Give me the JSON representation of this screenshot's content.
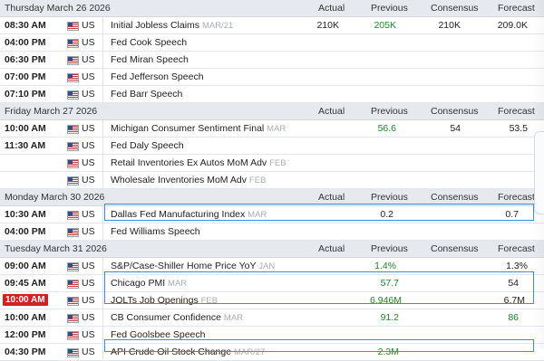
{
  "columns": {
    "actual": "Actual",
    "previous": "Previous",
    "consensus": "Consensus",
    "forecast": "Forecast"
  },
  "days": [
    {
      "date": "Thursday March 26 2026",
      "events": [
        {
          "time": "08:30 AM",
          "country": "US",
          "event": "Initial Jobless Claims",
          "ref": "MAR/21",
          "actual": "210K",
          "previous": "205K",
          "consensus": "210K",
          "forecast": "209.0K"
        },
        {
          "time": "04:00 PM",
          "country": "US",
          "event": "Fed Cook Speech",
          "ref": "",
          "actual": "",
          "previous": "",
          "consensus": "",
          "forecast": ""
        },
        {
          "time": "06:30 PM",
          "country": "US",
          "event": "Fed Miran Speech",
          "ref": "",
          "actual": "",
          "previous": "",
          "consensus": "",
          "forecast": ""
        },
        {
          "time": "07:00 PM",
          "country": "US",
          "event": "Fed Jefferson Speech",
          "ref": "",
          "actual": "",
          "previous": "",
          "consensus": "",
          "forecast": ""
        },
        {
          "time": "07:10 PM",
          "country": "US",
          "event": "Fed Barr Speech",
          "ref": "",
          "actual": "",
          "previous": "",
          "consensus": "",
          "forecast": ""
        }
      ]
    },
    {
      "date": "Friday March 27 2026",
      "events": [
        {
          "time": "10:00 AM",
          "country": "US",
          "event": "Michigan Consumer Sentiment Final",
          "ref": "MAR",
          "actual": "",
          "previous": "56.6",
          "consensus": "54",
          "forecast": "53.5"
        },
        {
          "time": "11:30 AM",
          "country": "US",
          "event": "Fed Daly Speech",
          "ref": "",
          "actual": "",
          "previous": "",
          "consensus": "",
          "forecast": ""
        },
        {
          "time": "",
          "country": "US",
          "event": "Retail Inventories Ex Autos MoM Adv",
          "ref": "FEB",
          "actual": "",
          "previous": "",
          "consensus": "",
          "forecast": ""
        },
        {
          "time": "",
          "country": "US",
          "event": "Wholesale Inventories MoM Adv",
          "ref": "FEB",
          "actual": "",
          "previous": "",
          "consensus": "",
          "forecast": ""
        }
      ]
    },
    {
      "date": "Monday March 30 2026",
      "events": [
        {
          "time": "10:30 AM",
          "country": "US",
          "event": "Dallas Fed Manufacturing Index",
          "ref": "MAR",
          "actual": "",
          "previous": "0.2",
          "consensus": "",
          "forecast": "0.7"
        },
        {
          "time": "04:00 PM",
          "country": "US",
          "event": "Fed Williams Speech",
          "ref": "",
          "actual": "",
          "previous": "",
          "consensus": "",
          "forecast": ""
        }
      ]
    },
    {
      "date": "Tuesday March 31 2026",
      "events": [
        {
          "time": "09:00 AM",
          "country": "US",
          "event": "S&P/Case-Shiller Home Price YoY",
          "ref": "JAN",
          "actual": "",
          "previous": "1.4%",
          "consensus": "",
          "forecast": "1.3%"
        },
        {
          "time": "09:45 AM",
          "country": "US",
          "event": "Chicago PMI",
          "ref": "MAR",
          "actual": "",
          "previous": "57.7",
          "consensus": "",
          "forecast": "54"
        },
        {
          "time": "10:00 AM",
          "country": "US",
          "event": "JOLTs Job Openings",
          "ref": "FEB",
          "actual": "",
          "previous": "6.946M",
          "consensus": "",
          "forecast": "6.7M"
        },
        {
          "time": "10:00 AM",
          "country": "US",
          "event": "CB Consumer Confidence",
          "ref": "MAR",
          "actual": "",
          "previous": "91.2",
          "consensus": "",
          "forecast": "86"
        },
        {
          "time": "12:00 PM",
          "country": "US",
          "event": "Fed Goolsbee Speech",
          "ref": "",
          "actual": "",
          "previous": "",
          "consensus": "",
          "forecast": ""
        },
        {
          "time": "04:30 PM",
          "country": "US",
          "event": "API Crude Oil Stock Change",
          "ref": "MAR/27",
          "actual": "",
          "previous": "2.3M",
          "consensus": "",
          "forecast": ""
        }
      ]
    }
  ],
  "highlighted_time": "10:00 AM",
  "colors": {
    "header_bg": "#e6e9ee",
    "previous_green": "#1a8a2a",
    "highlight_time_bg": "#d42020",
    "box_blue": "#3b8fd6"
  }
}
